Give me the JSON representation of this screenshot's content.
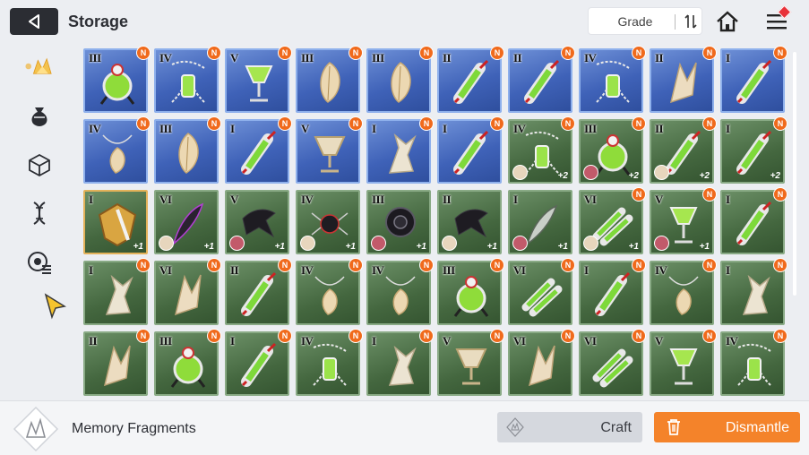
{
  "header": {
    "title": "Storage",
    "back_icon": "back-arrow-icon",
    "grade_label": "Grade",
    "sort_icon": "sort-order-icon",
    "home_icon": "home-icon",
    "menu_icon": "menu-icon"
  },
  "sidebar": {
    "items": [
      {
        "name": "memory-fragment-category",
        "icon": "fragment-icon",
        "active": true
      },
      {
        "name": "materials-category",
        "icon": "pouch-icon",
        "active": false
      },
      {
        "name": "cube-category",
        "icon": "cube-icon",
        "active": false
      },
      {
        "name": "gene-category",
        "icon": "dna-icon",
        "active": false
      },
      {
        "name": "pathfinding-category",
        "icon": "radar-icon",
        "active": false
      }
    ]
  },
  "grid": {
    "new_badge": "N",
    "rows": [
      [
        {
          "grade": "III",
          "color": "blue",
          "art": "orb",
          "new": true
        },
        {
          "grade": "IV",
          "color": "blue",
          "art": "vial-chain",
          "new": true
        },
        {
          "grade": "V",
          "color": "blue",
          "art": "goblet",
          "new": true
        },
        {
          "grade": "III",
          "color": "blue",
          "art": "feather",
          "new": true
        },
        {
          "grade": "III",
          "color": "blue",
          "art": "feather",
          "new": true
        },
        {
          "grade": "II",
          "color": "blue",
          "art": "syringe",
          "new": true
        },
        {
          "grade": "II",
          "color": "blue",
          "art": "syringe",
          "new": true
        },
        {
          "grade": "IV",
          "color": "blue",
          "art": "vial-chain",
          "new": true
        },
        {
          "grade": "II",
          "color": "blue",
          "art": "shard",
          "new": true
        },
        {
          "grade": "I",
          "color": "blue",
          "art": "syringe",
          "new": true
        }
      ],
      [
        {
          "grade": "IV",
          "color": "blue",
          "art": "necklace",
          "new": true
        },
        {
          "grade": "III",
          "color": "blue",
          "art": "feather",
          "new": true
        },
        {
          "grade": "I",
          "color": "blue",
          "art": "syringe",
          "new": true
        },
        {
          "grade": "V",
          "color": "blue",
          "art": "goblet-gold",
          "new": true
        },
        {
          "grade": "I",
          "color": "blue",
          "art": "bone",
          "new": true
        },
        {
          "grade": "I",
          "color": "blue",
          "art": "syringe",
          "new": true
        },
        {
          "grade": "IV",
          "color": "green",
          "art": "vial-chain",
          "new": true,
          "plus": "+2",
          "avatar": true
        },
        {
          "grade": "III",
          "color": "green",
          "art": "orb",
          "new": true,
          "plus": "+2",
          "avatar": true
        },
        {
          "grade": "II",
          "color": "green",
          "art": "syringe",
          "new": true,
          "plus": "+2",
          "avatar": true
        },
        {
          "grade": "I",
          "color": "green",
          "art": "syringe",
          "new": true,
          "plus": "+2"
        }
      ],
      [
        {
          "grade": "I",
          "color": "gold",
          "art": "shield",
          "new": false,
          "plus": "+1"
        },
        {
          "grade": "VI",
          "color": "green",
          "art": "quill-dark",
          "new": false,
          "plus": "+1",
          "avatar": true
        },
        {
          "grade": "V",
          "color": "green",
          "art": "crow",
          "new": false,
          "plus": "+1",
          "avatar": true
        },
        {
          "grade": "IV",
          "color": "green",
          "art": "spider",
          "new": false,
          "plus": "+1",
          "avatar": true
        },
        {
          "grade": "III",
          "color": "green",
          "art": "rose",
          "new": false,
          "plus": "+1",
          "avatar": true
        },
        {
          "grade": "II",
          "color": "green",
          "art": "crow",
          "new": false,
          "plus": "+1",
          "avatar": true
        },
        {
          "grade": "I",
          "color": "green",
          "art": "quill",
          "new": false,
          "plus": "+1",
          "avatar": true
        },
        {
          "grade": "VI",
          "color": "green",
          "art": "syringe-cluster",
          "new": true,
          "plus": "+1",
          "avatar": true
        },
        {
          "grade": "V",
          "color": "green",
          "art": "goblet",
          "new": true,
          "plus": "+1",
          "avatar": true
        },
        {
          "grade": "I",
          "color": "green",
          "art": "syringe",
          "new": true
        }
      ],
      [
        {
          "grade": "I",
          "color": "green",
          "art": "bone",
          "new": true
        },
        {
          "grade": "VI",
          "color": "green",
          "art": "shard",
          "new": true
        },
        {
          "grade": "II",
          "color": "green",
          "art": "syringe",
          "new": true
        },
        {
          "grade": "IV",
          "color": "green",
          "art": "necklace",
          "new": true
        },
        {
          "grade": "IV",
          "color": "green",
          "art": "necklace",
          "new": true
        },
        {
          "grade": "III",
          "color": "green",
          "art": "orb",
          "new": true
        },
        {
          "grade": "VI",
          "color": "green",
          "art": "syringe-cluster",
          "new": true
        },
        {
          "grade": "I",
          "color": "green",
          "art": "syringe",
          "new": true
        },
        {
          "grade": "IV",
          "color": "green",
          "art": "necklace",
          "new": true
        },
        {
          "grade": "I",
          "color": "green",
          "art": "bone",
          "new": true
        }
      ],
      [
        {
          "grade": "II",
          "color": "green",
          "art": "shard",
          "new": true
        },
        {
          "grade": "III",
          "color": "green",
          "art": "orb",
          "new": true
        },
        {
          "grade": "I",
          "color": "green",
          "art": "syringe",
          "new": true
        },
        {
          "grade": "IV",
          "color": "green",
          "art": "vial-chain",
          "new": true
        },
        {
          "grade": "I",
          "color": "green",
          "art": "bone",
          "new": true
        },
        {
          "grade": "V",
          "color": "green",
          "art": "goblet-gold",
          "new": true
        },
        {
          "grade": "VI",
          "color": "green",
          "art": "shard",
          "new": true
        },
        {
          "grade": "VI",
          "color": "green",
          "art": "syringe-cluster",
          "new": true
        },
        {
          "grade": "V",
          "color": "green",
          "art": "goblet",
          "new": true
        },
        {
          "grade": "IV",
          "color": "green",
          "art": "vial-chain",
          "new": true
        }
      ]
    ]
  },
  "footer": {
    "fragments_label": "Memory Fragments",
    "fragments_icon": "crystal-icon",
    "craft_label": "Craft",
    "craft_icon": "crystal-icon",
    "dismantle_label": "Dismantle",
    "dismantle_icon": "trash-icon"
  },
  "colors": {
    "accent": "#f4832a",
    "badge": "#f06a1c",
    "card_blue": "#3f62b8",
    "card_green": "#44673f",
    "card_gold_border": "#e3b25a",
    "active_sidebar": "#f0b43c"
  }
}
